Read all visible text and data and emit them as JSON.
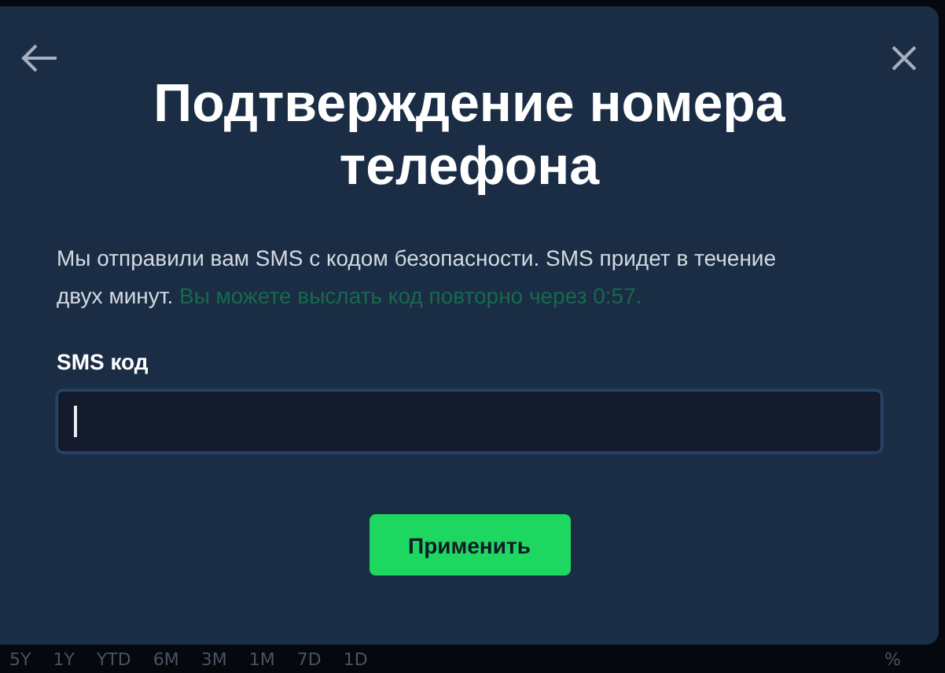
{
  "dialog": {
    "title": "Подтверждение номера телефона",
    "message": "Мы отправили вам SMS с кодом безопасности. SMS придет в течение двух минут.",
    "resend_note": "Вы можете выслать код повторно через 0:57.",
    "field": {
      "label": "SMS код",
      "focused": true
    },
    "submit_button": "Применить"
  },
  "background": {
    "range_buttons": [
      "5Y",
      "1Y",
      "YTD",
      "6M",
      "3M",
      "1M",
      "7D",
      "1D"
    ],
    "percent_toggle": "%"
  }
}
